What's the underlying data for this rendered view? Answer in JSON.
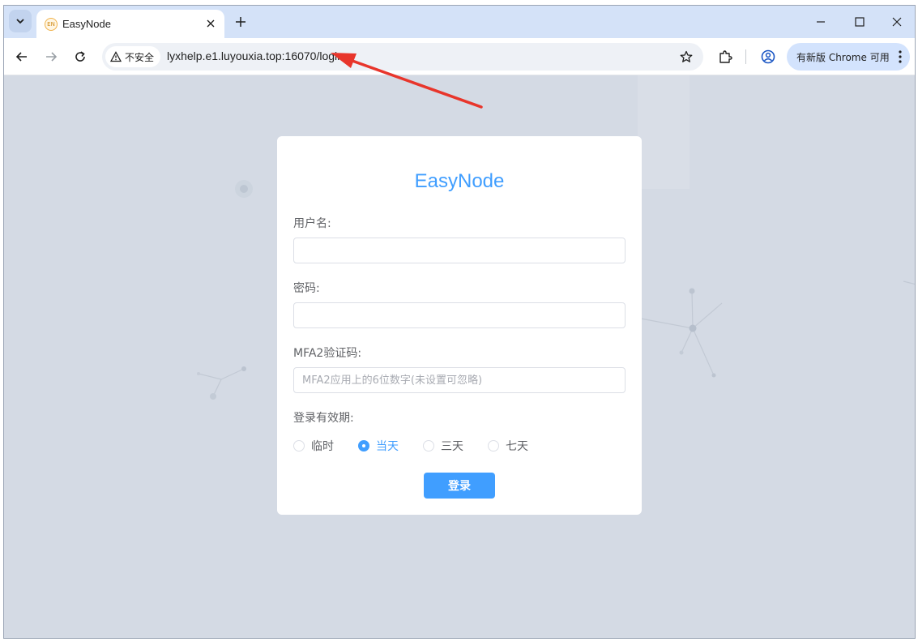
{
  "browser": {
    "tab_title": "EasyNode",
    "tab_favicon_text": "EN",
    "security_label": "不安全",
    "url": "lyxhelp.e1.luyouxia.top:16070/login",
    "update_label": "有新版 Chrome 可用"
  },
  "login": {
    "title": "EasyNode",
    "username_label": "用户名:",
    "username_value": "",
    "password_label": "密码:",
    "password_value": "",
    "mfa_label": "MFA2验证码:",
    "mfa_placeholder": "MFA2应用上的6位数字(未设置可忽略)",
    "validity_label": "登录有效期:",
    "validity_options": [
      {
        "label": "临时",
        "checked": false
      },
      {
        "label": "当天",
        "checked": true
      },
      {
        "label": "三天",
        "checked": false
      },
      {
        "label": "七天",
        "checked": false
      }
    ],
    "submit_label": "登录"
  },
  "colors": {
    "accent": "#409eff",
    "annotation_arrow": "#e8352b"
  },
  "icons": [
    "tab-search-icon",
    "close-icon",
    "plus-icon",
    "minimize-icon",
    "maximize-icon",
    "back-arrow-icon",
    "forward-arrow-icon",
    "reload-icon",
    "warning-icon",
    "star-icon",
    "extensions-icon",
    "profile-icon",
    "more-vert-icon"
  ]
}
